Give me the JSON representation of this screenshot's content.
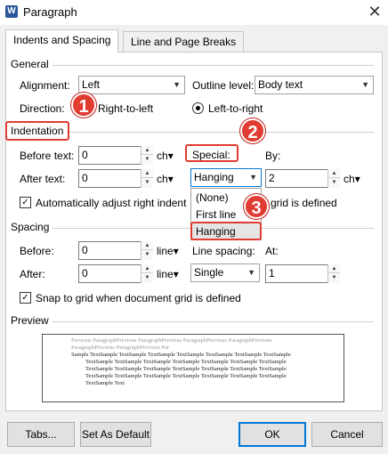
{
  "window": {
    "app_icon_letter": "W",
    "title": "Paragraph",
    "close_glyph": "✕"
  },
  "tabs": [
    {
      "label": "Indents and Spacing",
      "active": true
    },
    {
      "label": "Line and Page Breaks",
      "active": false
    }
  ],
  "general": {
    "heading": "General",
    "alignment_label": "Alignment:",
    "alignment_value": "Left",
    "outline_label": "Outline level:",
    "outline_value": "Body text",
    "direction_label": "Direction:",
    "rtl_label": "Right-to-left",
    "ltr_label": "Left-to-right",
    "direction_selected": "Left-to-right"
  },
  "indentation": {
    "heading": "Indentation",
    "before_label": "Before text:",
    "before_value": "0",
    "after_label": "After text:",
    "after_value": "0",
    "unit": "ch",
    "special_label": "Special:",
    "special_value": "Hanging",
    "special_options": [
      "(None)",
      "First line",
      "Hanging"
    ],
    "by_label": "By:",
    "by_value": "2",
    "auto_adjust_label": "Automatically adjust right indent",
    "auto_adjust_tail": "grid is defined",
    "auto_adjust_checked": true
  },
  "spacing": {
    "heading": "Spacing",
    "before_label": "Before:",
    "before_value": "0",
    "after_label": "After:",
    "after_value": "0",
    "unit": "line",
    "line_spacing_label": "Line spacing:",
    "line_spacing_value": "Single",
    "at_label": "At:",
    "at_value": "1",
    "snap_label": "Snap to grid when document grid is defined",
    "snap_checked": true
  },
  "preview": {
    "heading": "Preview",
    "prev_lines": [
      "Previous ParagraphPrevious ParagraphPrevious ParagraphPrevious ParagraphPrevious",
      "ParagraphPrevious ParagraphPrevious Par"
    ],
    "sample_lines": [
      "Sample TextSample TextSample TextSample TextSample TextSample TextSample TextSample",
      "TextSample TextSample TextSample TextSample TextSample TextSample TextSample",
      "TextSample TextSample TextSample TextSample TextSample TextSample TextSample",
      "TextSample TextSample TextSample TextSample TextSample TextSample TextSample",
      "TextSample Text"
    ]
  },
  "buttons": {
    "tabs": "Tabs...",
    "set_default": "Set As Default",
    "ok": "OK",
    "cancel": "Cancel"
  },
  "markers": [
    "1",
    "2",
    "3"
  ],
  "glyphs": {
    "dropdown_arrow": "▼",
    "small_arrow": "▾",
    "spin_up": "▲",
    "spin_down": "▼",
    "check": "✓"
  },
  "colors": {
    "marker_red": "#e03c31",
    "accent_blue": "#0078d7",
    "word_blue": "#2b579a"
  }
}
